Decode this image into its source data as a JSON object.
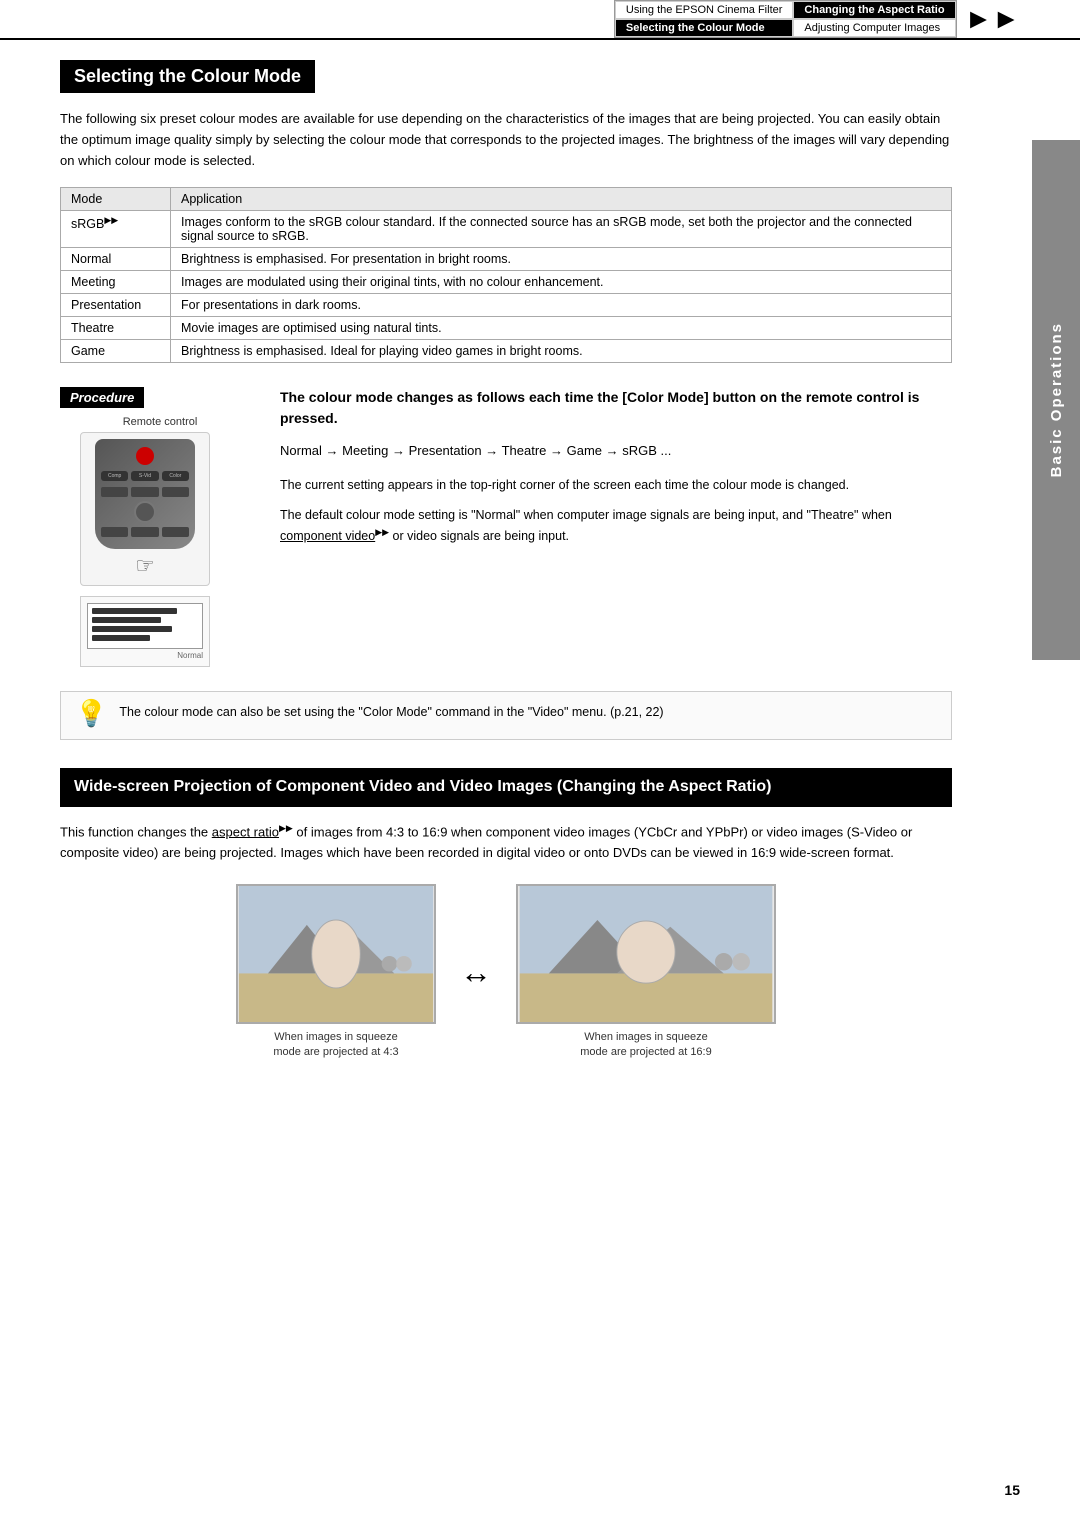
{
  "header": {
    "nav_items": [
      {
        "label": "Using the EPSON Cinema Filter",
        "active": false
      },
      {
        "label": "Changing the Aspect Ratio",
        "active": true
      },
      {
        "label": "Selecting the Colour Mode",
        "active": true
      },
      {
        "label": "Adjusting Computer Images",
        "active": false
      }
    ]
  },
  "sidebar": {
    "label": "Basic Operations"
  },
  "section1": {
    "heading": "Selecting the Colour Mode",
    "intro": "The following six preset colour modes are available for use depending on the characteristics of the images that are being projected. You can easily obtain the optimum image quality simply by selecting the colour mode that corresponds to the projected images. The brightness of the images will vary depending on which colour mode is selected.",
    "table": {
      "col_mode": "Mode",
      "col_app": "Application",
      "rows": [
        {
          "mode": "sRGB",
          "mode_suffix": "▶▶",
          "app": "Images conform to the sRGB colour standard. If the connected source has an sRGB mode, set both the projector and the connected signal source to sRGB."
        },
        {
          "mode": "Normal",
          "app": "Brightness is emphasised. For presentation in bright rooms."
        },
        {
          "mode": "Meeting",
          "app": "Images are modulated using their original tints, with no colour enhancement."
        },
        {
          "mode": "Presentation",
          "app": "For presentations in dark rooms."
        },
        {
          "mode": "Theatre",
          "app": "Movie images are optimised using natural tints."
        },
        {
          "mode": "Game",
          "app": "Brightness is emphasised. Ideal for playing video games in bright rooms."
        }
      ]
    }
  },
  "procedure": {
    "badge": "Procedure",
    "remote_label": "Remote control",
    "screen_label": "Normal",
    "title": "The colour mode changes as follows each time the [Color Mode] button on the remote control is pressed.",
    "arrow_sequence": "Normal → Meeting → Presentation → Theatre → Game → sRGB ...",
    "description1": "The current setting appears in the top-right corner of the screen each time the colour mode is changed.",
    "description2": "The default colour mode setting is \"Normal\" when computer image signals are being input, and \"Theatre\" when component video▶▶ or video signals are being input."
  },
  "tip": {
    "text": "The colour mode can also be set using the \"Color Mode\" command in the \"Video\" menu. (p.21, 22)"
  },
  "section2": {
    "heading": "Wide-screen Projection of Component Video and Video Images (Changing the Aspect Ratio)",
    "text": "This function changes the aspect ratio▶▶ of images from 4:3 to 16:9 when component video images (YCbCr and YPbPr) or video images (S-Video or composite video) are being projected. Images which have been recorded in digital video or onto DVDs can be viewed in 16:9 wide-screen format.",
    "caption1_line1": "When images in squeeze",
    "caption1_line2": "mode are projected at 4:3",
    "caption2_line1": "When images in squeeze",
    "caption2_line2": "mode are projected at 16:9"
  },
  "page_number": "15"
}
